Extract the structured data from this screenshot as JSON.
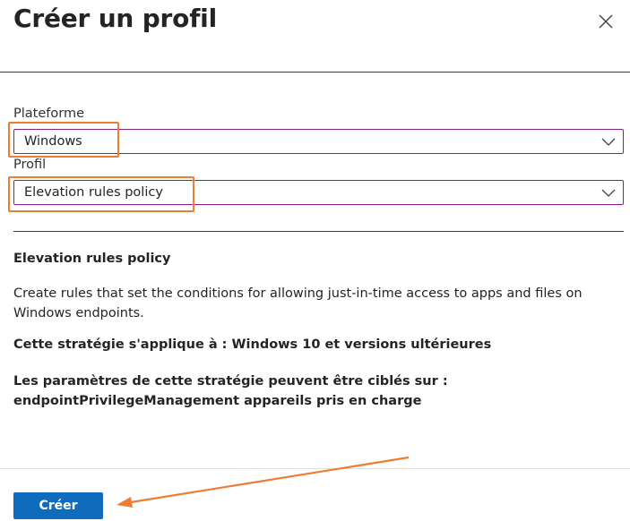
{
  "header": {
    "title": "Créer un profil",
    "close_icon": "close-icon"
  },
  "form": {
    "platform": {
      "label": "Plateforme",
      "value": "Windows"
    },
    "profile": {
      "label": "Profil",
      "value": "Elevation rules policy"
    }
  },
  "description": {
    "title": "Elevation rules policy",
    "text": "Create rules that set the conditions for allowing just-in-time access to apps and files on Windows endpoints.",
    "applies_to": "Cette stratégie s'applique à : Windows 10 et versions ultérieures",
    "targets": "Les paramètres de cette stratégie peuvent être ciblés sur : endpointPrivilegeManagement appareils pris en charge"
  },
  "footer": {
    "create_label": "Créer"
  },
  "colors": {
    "accent": "#0f6cbd",
    "focus_border": "#8a1d8a",
    "annotation": "#ed7d31"
  }
}
